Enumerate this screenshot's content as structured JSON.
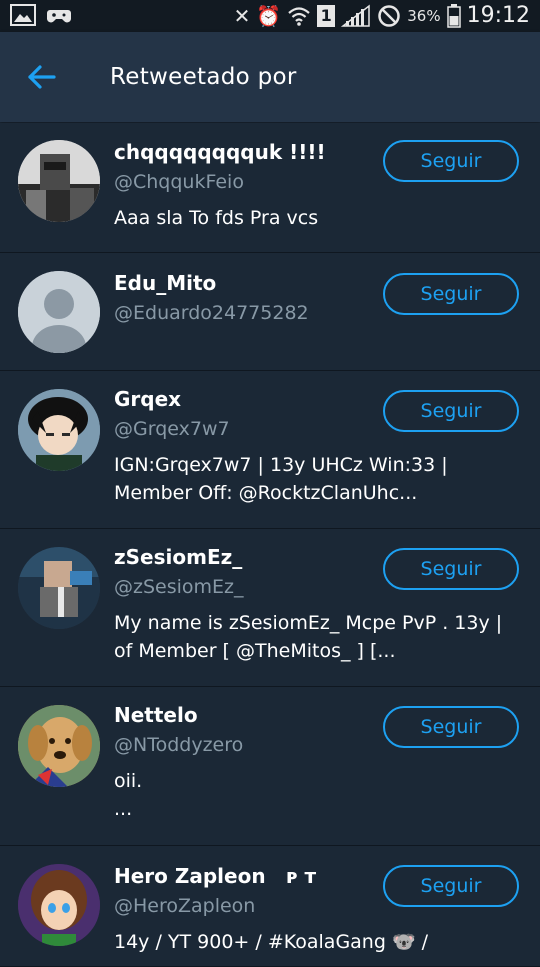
{
  "status_bar": {
    "battery_percent": "36%",
    "time": "19:12",
    "sim_number": "1",
    "icons": [
      "image-icon",
      "game-controller-icon",
      "nfc-off-icon",
      "alarm-icon",
      "wifi-icon",
      "sim-icon",
      "signal-icon",
      "do-not-disturb-icon",
      "battery-icon"
    ]
  },
  "header": {
    "title": "Retweetado por",
    "back_icon": "back-arrow-icon"
  },
  "colors": {
    "accent": "#1da1f2",
    "background": "#1b2836",
    "header": "#243447",
    "secondary_text": "#8899a6"
  },
  "users": [
    {
      "name": "chqqqqqqqquk !!!!",
      "handle": "@ChqqukFeio",
      "bio": "Aaa sla To fds Pra vcs",
      "button": "Seguir"
    },
    {
      "name": "Edu_Mito",
      "handle": "@Eduardo24775282",
      "bio": "",
      "button": "Seguir"
    },
    {
      "name": "Grqex",
      "handle": "@Grqex7w7",
      "bio": "IGN:Grqex7w7 | 13y UHCz Win:33 | Member Off: @RocktzClanUhc...",
      "button": "Seguir"
    },
    {
      "name": "zSesiomEz_",
      "handle": "@zSesiomEz_",
      "bio": "My name is zSesiomEz_ Mcpe PvP . 13y | of Member [ @TheMitos_ ] [...",
      "button": "Seguir"
    },
    {
      "name": "Nettelo",
      "handle": "@NToddyzero",
      "bio": "oii.\n...",
      "button": "Seguir"
    },
    {
      "name": "Hero Zapleon   ᴘ ᴛ",
      "handle": "@HeroZapleon",
      "bio": "14y / YT 900+ / #KoalaGang 🐨 /",
      "button": "Seguir"
    }
  ]
}
